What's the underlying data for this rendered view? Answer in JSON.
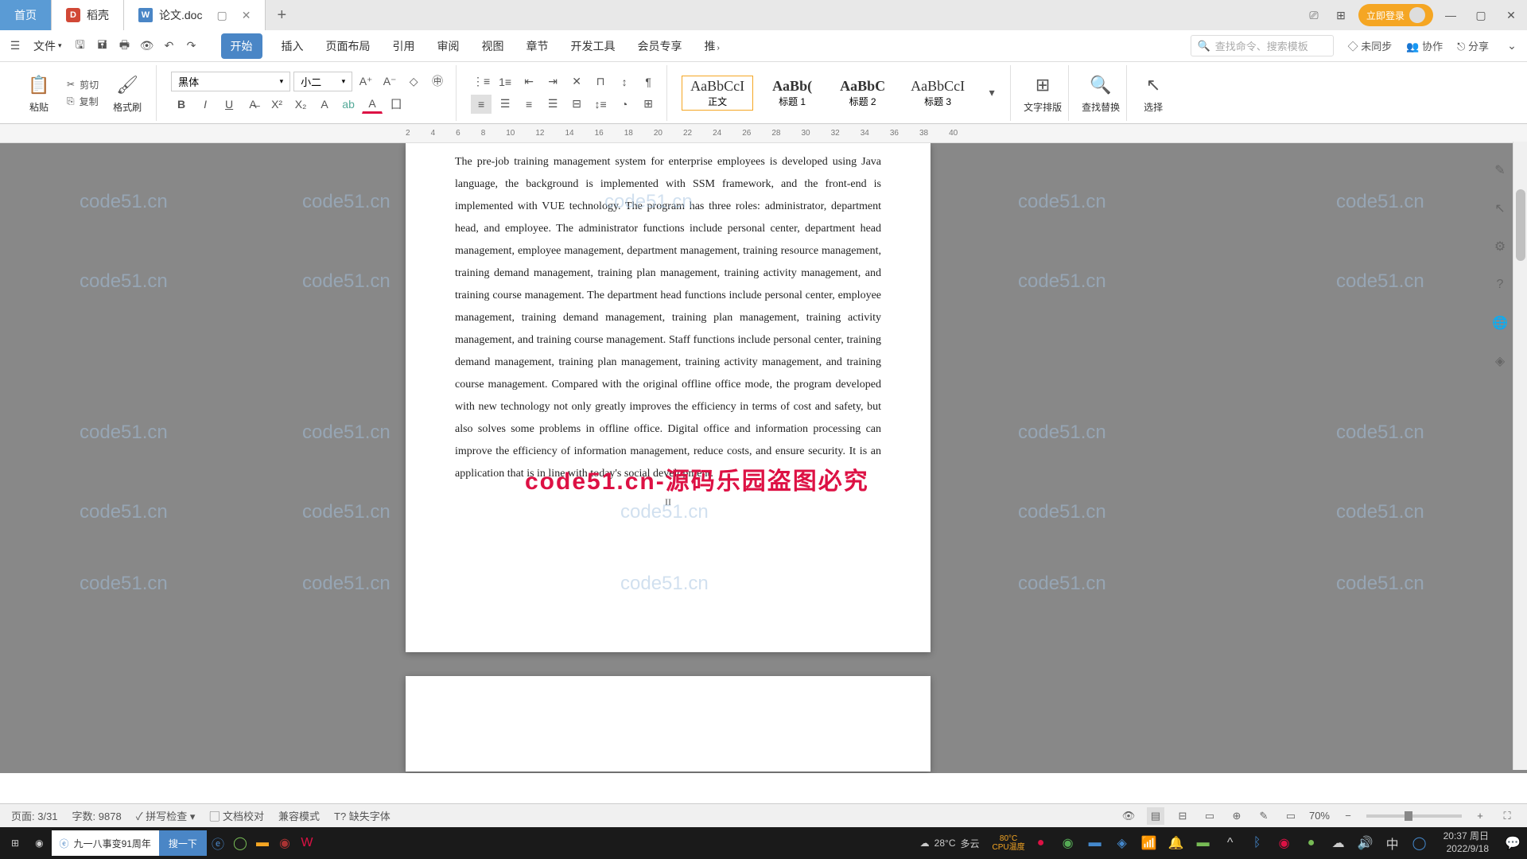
{
  "titlebar": {
    "home_tab": "首页",
    "doke_tab": "稻壳",
    "doc_tab": "论文.doc",
    "login": "立即登录"
  },
  "menubar": {
    "file": "文件",
    "tabs": [
      "开始",
      "插入",
      "页面布局",
      "引用",
      "审阅",
      "视图",
      "章节",
      "开发工具",
      "会员专享",
      "推"
    ],
    "search_placeholder": "查找命令、搜索模板",
    "unsync": "未同步",
    "collab": "协作",
    "share": "分享"
  },
  "ribbon": {
    "paste": "粘贴",
    "cut": "剪切",
    "copy": "复制",
    "format_painter": "格式刷",
    "font_name": "黑体",
    "font_size": "小二",
    "styles": [
      {
        "preview": "AaBbCcI",
        "name": "正文",
        "bold": false
      },
      {
        "preview": "AaBb(",
        "name": "标题 1",
        "bold": true
      },
      {
        "preview": "AaBbC",
        "name": "标题 2",
        "bold": true
      },
      {
        "preview": "AaBbCcI",
        "name": "标题 3",
        "bold": false
      }
    ],
    "text_layout": "文字排版",
    "find_replace": "查找替换",
    "select": "选择"
  },
  "ruler": [
    "2",
    "4",
    "6",
    "8",
    "10",
    "12",
    "14",
    "16",
    "18",
    "20",
    "22",
    "24",
    "26",
    "28",
    "30",
    "32",
    "34",
    "36",
    "38",
    "40"
  ],
  "document": {
    "body": "The pre-job training management system for enterprise employees is developed using Java language, the background is implemented with SSM framework, and the front-end is implemented with VUE technology. The program has three roles: administrator, department head, and employee. The administrator functions include personal center, department head management, employee management, department management, training resource management, training demand management, training plan management, training activity management, and training course management. The department head functions include personal center, employee management, training demand management, training plan management, training activity management, and training course management. Staff functions include personal center, training demand management, training plan management, training activity management, and training course management. Compared with the original offline office mode, the program developed with new technology not only greatly improves the efficiency in terms of cost and safety, but also solves some problems in offline office. Digital office and information processing can improve the efficiency of information management, reduce costs, and ensure security. It is an application that is in line with today's social development.",
    "page_num": "II",
    "red_overlay": "code51.cn-源码乐园盗图必究"
  },
  "watermark": "code51.cn",
  "statusbar": {
    "page": "页面: 3/31",
    "words": "字数: 9878",
    "spellcheck": "拼写检查",
    "doc_proof": "文档校对",
    "compat": "兼容模式",
    "missing_font": "缺失字体",
    "zoom": "70%"
  },
  "taskbar": {
    "news": "九一八事变91周年",
    "search_btn": "搜一下",
    "temp": "28°C",
    "weather": "多云",
    "cpu_temp": "80°C",
    "cpu_label": "CPU温度",
    "ime": "中",
    "time": "20:37 周日",
    "date": "2022/9/18"
  }
}
